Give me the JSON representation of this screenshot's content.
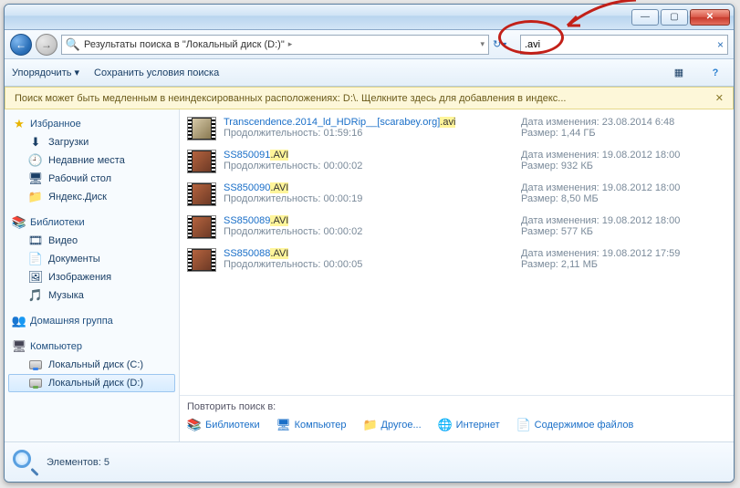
{
  "titlebar": {
    "min": "—",
    "max": "▢",
    "close": "✕"
  },
  "nav": {
    "back": "←",
    "fwd": "→",
    "crumb": "Результаты поиска в \"Локальный диск (D:)\"",
    "sep": "▸",
    "refresh": "↻"
  },
  "search": {
    "value": ".avi",
    "clear": "×"
  },
  "toolbar": {
    "organize": "Упорядочить ▾",
    "save": "Сохранить условия поиска",
    "view_icon": "▦",
    "help_icon": "?"
  },
  "warn": {
    "text": "Поиск может быть медленным в неиндексированных расположениях: D:\\. Щелкните здесь для добавления в индекс...",
    "x": "✕"
  },
  "sidebar": {
    "fav": {
      "label": "Избранное",
      "items": [
        {
          "icon": "⬇",
          "label": "Загрузки",
          "name": "sb-downloads"
        },
        {
          "icon": "🕘",
          "label": "Недавние места",
          "name": "sb-recent"
        },
        {
          "icon": "🖥",
          "label": "Рабочий стол",
          "name": "sb-desktop"
        },
        {
          "icon": "📁",
          "label": "Яндекс.Диск",
          "name": "sb-yadisk"
        }
      ]
    },
    "lib": {
      "label": "Библиотеки",
      "items": [
        {
          "icon": "🎞",
          "label": "Видео",
          "name": "sb-video"
        },
        {
          "icon": "📄",
          "label": "Документы",
          "name": "sb-docs"
        },
        {
          "icon": "🖼",
          "label": "Изображения",
          "name": "sb-pictures"
        },
        {
          "icon": "🎵",
          "label": "Музыка",
          "name": "sb-music"
        }
      ]
    },
    "home": {
      "icon": "👥",
      "label": "Домашняя группа"
    },
    "comp": {
      "label": "Компьютер",
      "items": [
        {
          "label": "Локальный диск (C:)",
          "name": "sb-drive-c"
        },
        {
          "label": "Локальный диск (D:)",
          "name": "sb-drive-d",
          "sel": true
        }
      ]
    }
  },
  "results": [
    {
      "name_pre": "Transcendence.2014_ld_HDRip__[scarabey.org]",
      "name_ext": ".avi",
      "sub_label": "Продолжительность:",
      "sub_val": "01:59:16",
      "meta_date_label": "Дата изменения:",
      "meta_date": "23.08.2014 6:48",
      "meta_size_label": "Размер:",
      "meta_size": "1,44 ГБ",
      "first": true
    },
    {
      "name_pre": "SS850091",
      "name_ext": ".AVI",
      "sub_label": "Продолжительность:",
      "sub_val": "00:00:02",
      "meta_date_label": "Дата изменения:",
      "meta_date": "19.08.2012 18:00",
      "meta_size_label": "Размер:",
      "meta_size": "932 КБ"
    },
    {
      "name_pre": "SS850090",
      "name_ext": ".AVI",
      "sub_label": "Продолжительность:",
      "sub_val": "00:00:19",
      "meta_date_label": "Дата изменения:",
      "meta_date": "19.08.2012 18:00",
      "meta_size_label": "Размер:",
      "meta_size": "8,50 МБ"
    },
    {
      "name_pre": "SS850089",
      "name_ext": ".AVI",
      "sub_label": "Продолжительность:",
      "sub_val": "00:00:02",
      "meta_date_label": "Дата изменения:",
      "meta_date": "19.08.2012 18:00",
      "meta_size_label": "Размер:",
      "meta_size": "577 КБ"
    },
    {
      "name_pre": "SS850088",
      "name_ext": ".AVI",
      "sub_label": "Продолжительность:",
      "sub_val": "00:00:05",
      "meta_date_label": "Дата изменения:",
      "meta_date": "19.08.2012 17:59",
      "meta_size_label": "Размер:",
      "meta_size": "2,11 МБ"
    }
  ],
  "again": {
    "label": "Повторить поиск в:",
    "links": [
      {
        "icon": "📚",
        "label": "Библиотеки",
        "name": "again-libs"
      },
      {
        "icon": "🖥",
        "label": "Компьютер",
        "name": "again-comp"
      },
      {
        "icon": "📁",
        "label": "Другое...",
        "name": "again-other"
      },
      {
        "icon": "🌐",
        "label": "Интернет",
        "name": "again-internet"
      },
      {
        "icon": "📄",
        "label": "Содержимое файлов",
        "name": "again-contents"
      }
    ]
  },
  "status": {
    "label": "Элементов: 5"
  }
}
